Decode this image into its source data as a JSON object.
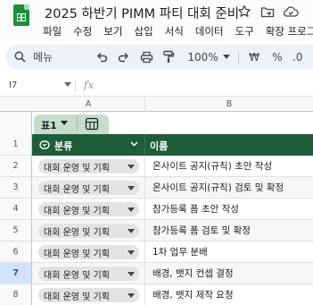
{
  "app": {
    "title": "2025 하반기 PIMM 파티 대회 준비",
    "menu": [
      "파일",
      "수정",
      "보기",
      "삽입",
      "서식",
      "데이터",
      "도구",
      "확장 프로그램"
    ]
  },
  "toolbar": {
    "search_label": "메뉴",
    "zoom": "100%",
    "currency": "₩",
    "percent": "%",
    "decimal": ".0"
  },
  "formula_bar": {
    "cell_ref": "I7",
    "fx": "fx",
    "value": ""
  },
  "columns": [
    "A",
    "B"
  ],
  "table": {
    "tab_label": "표1",
    "headers": [
      "분류",
      "이름"
    ],
    "row_numbers": [
      "1",
      "2",
      "3",
      "4",
      "5",
      "6",
      "7",
      "8"
    ],
    "selected_row": "7",
    "rows": [
      {
        "category": "대회 운영 및 기획",
        "name": "온사이트 공지(규칙) 초안 작성"
      },
      {
        "category": "대회 운영 및 기획",
        "name": "온사이트 공지(규칙) 검토 및 확정"
      },
      {
        "category": "대회 운영 및 기획",
        "name": "참가등록 폼 초안 작성"
      },
      {
        "category": "대회 운영 및 기획",
        "name": "참가등록 폼 검토 및 확정"
      },
      {
        "category": "대회 운영 및 기획",
        "name": "1차 업무 분배"
      },
      {
        "category": "대회 운영 및 기획",
        "name": "배경, 뱃지 컨셉 결정"
      },
      {
        "category": "대회 운영 및 기획",
        "name": "배경, 뱃지 제작 요청"
      }
    ]
  },
  "colors": {
    "header_bg": "#1e5c3a",
    "tab_chip": "#c6dccd",
    "chip_bg": "#e3e3e3",
    "selected_row": "#d3e3fd"
  }
}
